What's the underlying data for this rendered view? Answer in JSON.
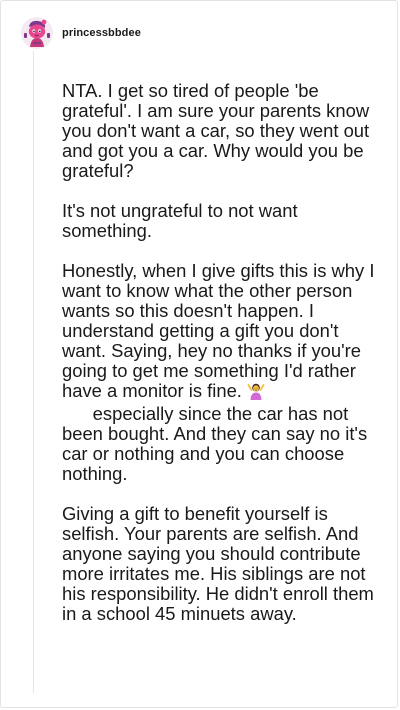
{
  "post": {
    "username": "princessbbdee",
    "avatar_icon": "pink-character-avatar-icon",
    "paragraphs": [
      "NTA. I get so tired of people 'be grateful'. I am sure your parents know you don't want a car, so they went out and got you a car. Why would you be grateful?",
      "It's not ungrateful to not want something.",
      {
        "before": "Honestly, when I give gifts this is why I want to know what the other person wants so this doesn't happen. I understand getting a gift you don't want. Saying, hey no thanks if you're going to get me something I'd rather have a monitor is fine.",
        "emoji": "person-shrugging-emoji",
        "after": "especially since the car has not been bought. And they can say no it's car or nothing and you can choose nothing."
      },
      "Giving a gift to benefit yourself is selfish. Your parents are selfish. And anyone saying you should contribute more irritates me. His siblings are not his responsibility. He didn't enroll them in a school 45 minuets away."
    ]
  },
  "colors": {
    "avatar_pink": "#e8488f",
    "avatar_purple": "#7b3a8c",
    "text": "#1a1a1a",
    "border": "#e3e3e3",
    "emoji_shirt": "#d16ad6",
    "emoji_skin": "#f7c34a"
  }
}
